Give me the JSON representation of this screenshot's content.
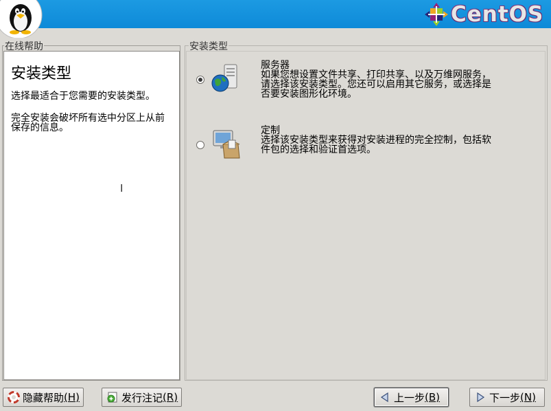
{
  "brand": {
    "name": "CentOS"
  },
  "help": {
    "frame_label": "在线帮助",
    "title": "安装类型",
    "paragraphs": [
      "选择最适合于您需要的安装类型。",
      "完全安装会破坏所有选中分区上从前保存的信息。"
    ]
  },
  "main": {
    "frame_label": "安装类型",
    "options": [
      {
        "title": "服务器",
        "description": "如果您想设置文件共享、打印共享、以及万维网服务，请选择该安装类型。您还可以启用其它服务，或选择是否要安装图形化环境。",
        "selected": true,
        "icon": "server-globe-icon"
      },
      {
        "title": "定制",
        "description": "选择该安装类型来获得对安装进程的完全控制，包括软件包的选择和验证首选项。",
        "selected": false,
        "icon": "custom-package-icon"
      }
    ]
  },
  "buttons": {
    "hide_help": {
      "label": "隐藏帮助",
      "accel": "(H)",
      "icon": "lifebuoy-icon"
    },
    "release_notes": {
      "label": "发行注记",
      "accel": "(R)",
      "icon": "notes-icon"
    },
    "back": {
      "label": "上一步",
      "accel": "(B)",
      "icon": "left-arrow-icon"
    },
    "next": {
      "label": "下一步",
      "accel": "(N)",
      "icon": "right-arrow-icon"
    }
  }
}
